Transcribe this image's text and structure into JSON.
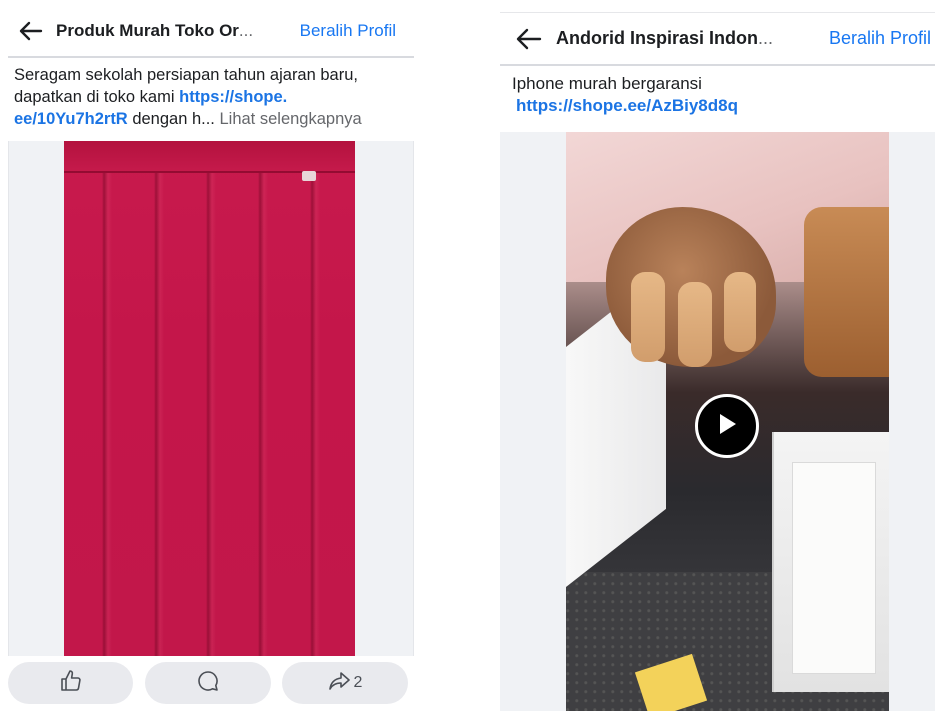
{
  "left_post": {
    "header": {
      "title": "Produk Murah Toko Or",
      "ellipsis": "...",
      "switch_profile": "Beralih Profil"
    },
    "caption": {
      "text_1": "Seragam sekolah persiapan tahun ajaran baru, dapatkan di toko kami ",
      "link": "https://shope. ee/10Yu7h2rtR",
      "text_2": " dengan h",
      "ellipsis": "...",
      "see_more": " Lihat selengkapnya"
    },
    "actions": {
      "share_count": "2"
    }
  },
  "right_post": {
    "header": {
      "title": "Andorid Inspirasi Indon",
      "ellipsis": "...",
      "switch_profile": "Beralih Profil"
    },
    "caption": {
      "text_1": "Iphone murah bergaransi",
      "link": "https://shope.ee/AzBiy8d8q"
    }
  },
  "colors": {
    "accent_link": "#1b74e4",
    "button_bg": "#e9eaee",
    "skirt": "#c4164a"
  },
  "icons": [
    "back-arrow-icon",
    "thumbs-up-icon",
    "comment-icon",
    "share-icon",
    "play-icon"
  ]
}
